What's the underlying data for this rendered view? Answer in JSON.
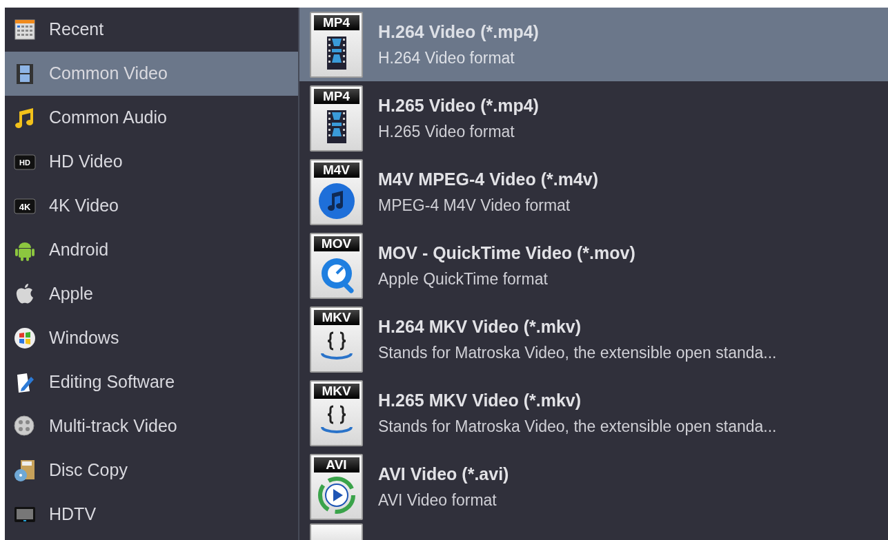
{
  "categories": [
    {
      "label": "Recent",
      "selected": false
    },
    {
      "label": "Common Video",
      "selected": true
    },
    {
      "label": "Common Audio",
      "selected": false
    },
    {
      "label": "HD Video",
      "selected": false,
      "badge": "HD"
    },
    {
      "label": "4K Video",
      "selected": false,
      "badge": "4K"
    },
    {
      "label": "Android",
      "selected": false
    },
    {
      "label": "Apple",
      "selected": false
    },
    {
      "label": "Windows",
      "selected": false
    },
    {
      "label": "Editing Software",
      "selected": false
    },
    {
      "label": "Multi-track Video",
      "selected": false
    },
    {
      "label": "Disc Copy",
      "selected": false
    },
    {
      "label": "HDTV",
      "selected": false
    }
  ],
  "formats": [
    {
      "badge": "MP4",
      "title": "H.264 Video (*.mp4)",
      "description": "H.264 Video format",
      "selected": true
    },
    {
      "badge": "MP4",
      "title": "H.265 Video (*.mp4)",
      "description": "H.265 Video format",
      "selected": false
    },
    {
      "badge": "M4V",
      "title": "M4V MPEG-4 Video (*.m4v)",
      "description": "MPEG-4 M4V Video format",
      "selected": false
    },
    {
      "badge": "MOV",
      "title": "MOV - QuickTime Video (*.mov)",
      "description": "Apple QuickTime format",
      "selected": false
    },
    {
      "badge": "MKV",
      "title": "H.264 MKV Video (*.mkv)",
      "description": "Stands for Matroska Video, the extensible open standa...",
      "selected": false
    },
    {
      "badge": "MKV",
      "title": "H.265 MKV Video (*.mkv)",
      "description": "Stands for Matroska Video, the extensible open standa...",
      "selected": false
    },
    {
      "badge": "AVI",
      "title": "AVI Video (*.avi)",
      "description": "AVI Video format",
      "selected": false
    }
  ]
}
